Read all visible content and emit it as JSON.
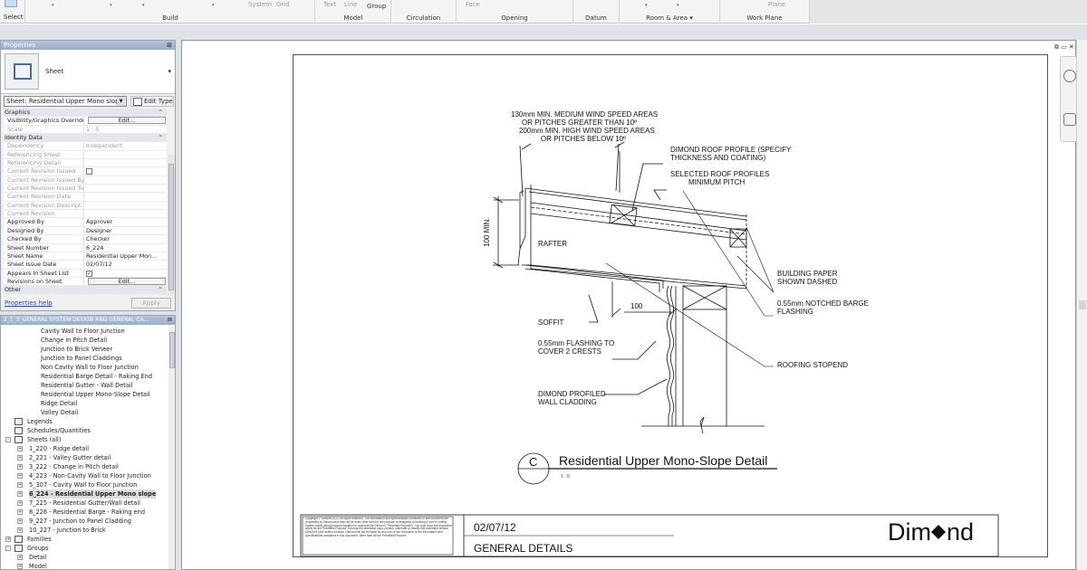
{
  "ribbon": {
    "select_label": "Select",
    "groups": [
      {
        "label": "Build",
        "subs": []
      },
      {
        "label": "",
        "subs": [
          "System",
          "Grid"
        ]
      },
      {
        "label": "Model",
        "subs": [
          "Text",
          "Line",
          "Group"
        ]
      },
      {
        "label": "Circulation",
        "subs": []
      },
      {
        "label": "Opening",
        "subs": [
          "Face"
        ]
      },
      {
        "label": "Datum",
        "subs": []
      },
      {
        "label": "Room & Area",
        "subs": []
      },
      {
        "label": "Work Plane",
        "subs": [
          "Plane"
        ]
      }
    ]
  },
  "properties": {
    "title": "Properties",
    "type_name": "Sheet",
    "sheet_selector": "Sheet: Residential Upper Mono slope",
    "edit_type": "Edit Type",
    "rows": [
      {
        "kind": "cat",
        "k": "Graphics"
      },
      {
        "kind": "row",
        "k": "Visibility/Graphics Overrides",
        "v": "Edit...",
        "btn": true
      },
      {
        "kind": "dim",
        "k": "Scale",
        "v": "1 : 5"
      },
      {
        "kind": "cat",
        "k": "Identity Data"
      },
      {
        "kind": "dim",
        "k": "Dependency",
        "v": "Independent"
      },
      {
        "kind": "dim",
        "k": "Referencing Sheet",
        "v": ""
      },
      {
        "kind": "dim",
        "k": "Referencing Detail",
        "v": ""
      },
      {
        "kind": "dim",
        "k": "Current Revision Issued",
        "v": "",
        "chk": true
      },
      {
        "kind": "dim",
        "k": "Current Revision Issued By",
        "v": ""
      },
      {
        "kind": "dim",
        "k": "Current Revision Issued To",
        "v": ""
      },
      {
        "kind": "dim",
        "k": "Current Revision Date",
        "v": ""
      },
      {
        "kind": "dim",
        "k": "Current Revision Descript...",
        "v": ""
      },
      {
        "kind": "dim",
        "k": "Current Revision",
        "v": ""
      },
      {
        "kind": "row",
        "k": "Approved By",
        "v": "Approver"
      },
      {
        "kind": "row",
        "k": "Designed By",
        "v": "Designer"
      },
      {
        "kind": "row",
        "k": "Checked By",
        "v": "Checker"
      },
      {
        "kind": "row",
        "k": "Sheet Number",
        "v": "6_224"
      },
      {
        "kind": "row",
        "k": "Sheet Name",
        "v": "Residential Upper Mon..."
      },
      {
        "kind": "row",
        "k": "Sheet Issue Date",
        "v": "02/07/12"
      },
      {
        "kind": "row",
        "k": "Appears In Sheet List",
        "v": "",
        "chk": true,
        "checked": true
      },
      {
        "kind": "row",
        "k": "Revisions on Sheet",
        "v": "Edit...",
        "btn": true
      },
      {
        "kind": "cat",
        "k": "Other"
      }
    ],
    "help_link": "Properties help",
    "apply_label": "Apply"
  },
  "browser": {
    "title": "2_1_3_GENERAL SYSTEM DESIGN AND GENERAL CA...",
    "items": [
      {
        "label": "Cavity Wall to Floor Junction",
        "indent": 44
      },
      {
        "label": "Change in Pitch Detail",
        "indent": 44
      },
      {
        "label": "Junction to Brick Veneer",
        "indent": 44
      },
      {
        "label": "Junction to Panel Claddings",
        "indent": 44
      },
      {
        "label": "Non Cavity Wall to Floor Junction",
        "indent": 44
      },
      {
        "label": "Residential Barge Detail - Raking End",
        "indent": 44
      },
      {
        "label": "Residential Gutter - Wall Detail",
        "indent": 44
      },
      {
        "label": "Residential Upper Mono-Slope Detail",
        "indent": 44
      },
      {
        "label": "Ridge Detail",
        "indent": 44
      },
      {
        "label": "Valley Detail",
        "indent": 44
      },
      {
        "label": "Legends",
        "indent": 29,
        "icon": true
      },
      {
        "label": "Schedules/Quantities",
        "indent": 29,
        "icon": true
      },
      {
        "label": "Sheets (all)",
        "indent": 29,
        "icon": true,
        "exp": "-",
        "expx": 5
      },
      {
        "label": "1_220 - Ridge detail",
        "indent": 31,
        "exp": "+",
        "expx": 18
      },
      {
        "label": "2_221 - Valley Gutter detail",
        "indent": 31,
        "exp": "+",
        "expx": 18
      },
      {
        "label": "3_222 - Change in Pitch detail",
        "indent": 31,
        "exp": "+",
        "expx": 18
      },
      {
        "label": "4_223 - Non-Cavity Wall to Floor Junction",
        "indent": 31,
        "exp": "+",
        "expx": 18
      },
      {
        "label": "5_307 - Cavity Wall to Floor Junction",
        "indent": 31,
        "exp": "+",
        "expx": 18
      },
      {
        "label": "6_224 - Residential Upper Mono slope",
        "indent": 31,
        "exp": "+",
        "expx": 18,
        "current": true
      },
      {
        "label": "7_225 - Residential Gutter/Wall detail",
        "indent": 31,
        "exp": "+",
        "expx": 18
      },
      {
        "label": "8_226 - Residential Barge - Raking end",
        "indent": 31,
        "exp": "+",
        "expx": 18
      },
      {
        "label": "9_227 - Junction to Panel Cladding",
        "indent": 31,
        "exp": "+",
        "expx": 18
      },
      {
        "label": "10_227 - Junction to Brick",
        "indent": 31,
        "exp": "+",
        "expx": 18
      },
      {
        "label": "Families",
        "indent": 29,
        "icon": true,
        "exp": "+",
        "expx": 5
      },
      {
        "label": "Groups",
        "indent": 29,
        "icon": true,
        "exp": "-",
        "expx": 5
      },
      {
        "label": "Detail",
        "indent": 31,
        "exp": "+",
        "expx": 18
      },
      {
        "label": "Model",
        "indent": 31,
        "exp": "+",
        "expx": 18
      }
    ]
  },
  "drawing": {
    "notes": {
      "wind_1": "130mm MIN. MEDIUM WIND SPEED AREAS",
      "wind_2": "OR PITCHES GREATER THAN 10º",
      "wind_3": "200mm MIN. HIGH WIND SPEED AREAS",
      "wind_4": "OR PITCHES BELOW 10º",
      "profile_1": "DIMOND ROOF PROFILE (SPECIFY",
      "profile_2": "THICKNESS AND COATING)",
      "selected_1": "SELECTED ROOF PROFILES",
      "selected_2": "MINIMUM PITCH",
      "dim_100_min": "100 MIN.",
      "rafter": "RAFTER",
      "paper_1": "BUILDING PAPER",
      "paper_2": "SHOWN DASHED",
      "barge_1": "0.55mm NOTCHED BARGE",
      "barge_2": "FLASHING",
      "dim_100": "100",
      "soffit": "SOFFIT",
      "flash_1": "0.55mm FLASHING TO",
      "flash_2": "COVER 2 CRESTS",
      "stopend": "ROOFING STOPEND",
      "clad_1": "DIMOND PROFILED",
      "clad_2": "WALL CLADDING"
    },
    "view_tag": "C",
    "view_title": "Residential Upper Mono-Slope Detail",
    "view_scale": "1 : 5"
  },
  "titleblock": {
    "copyright": "Copyright © Dimond 2012, all rights reserved. The information and specifications contained in this document are proprietary to Dimond and may not be used other than for the purpose of designing or building a roof or roofing system solely using products supplied or approved by Dimond (\"Permitted Purpose\"). You may copy this document solely for the Permitted Purpose, but may not otherwise copy, publish, distribute or modify this document without Dimond's prior written consent. Dimond will not be liable for any use of this document or the information and specifications contained in this document, other than for the Permitted Purpose.",
    "date": "02/07/12",
    "sheet_title": "GENERAL DETAILS",
    "logo_left": "Dim",
    "logo_right": "nd"
  },
  "colors": {
    "accent": "#98aecb",
    "ink": "#111111"
  }
}
